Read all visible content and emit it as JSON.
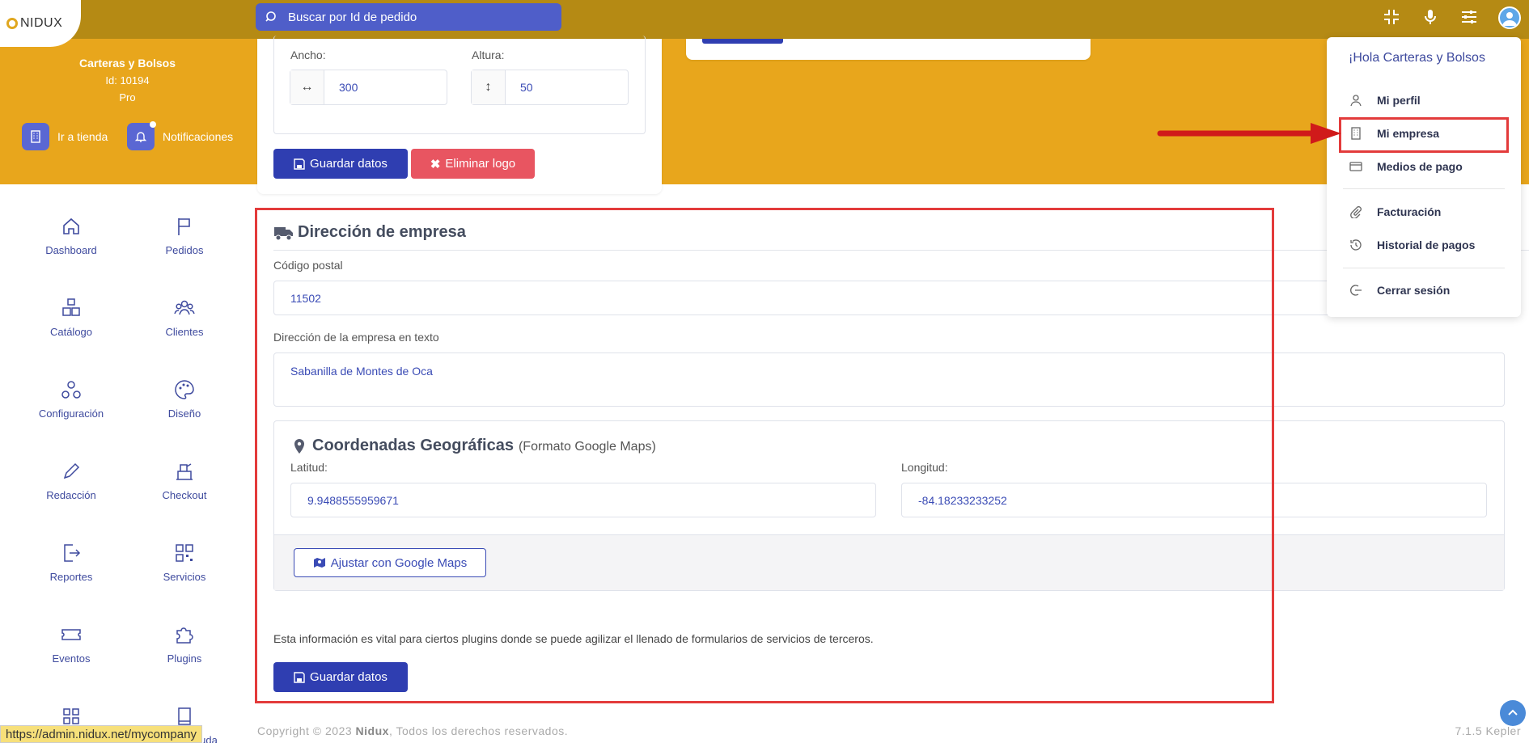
{
  "topbar": {
    "logo_text": "NIDUX",
    "search_placeholder": "Buscar por Id de pedido"
  },
  "store": {
    "name": "Carteras y Bolsos",
    "id_label": "Id: 10194",
    "plan": "Pro",
    "go_store": "Ir a tienda",
    "notifications": "Notificaciones"
  },
  "sidebar": {
    "items": [
      {
        "label": "Dashboard",
        "icon": "home-icon"
      },
      {
        "label": "Pedidos",
        "icon": "flag-icon"
      },
      {
        "label": "Catálogo",
        "icon": "boxes-icon"
      },
      {
        "label": "Clientes",
        "icon": "users-icon"
      },
      {
        "label": "Configuración",
        "icon": "nodes-icon"
      },
      {
        "label": "Diseño",
        "icon": "palette-icon"
      },
      {
        "label": "Redacción",
        "icon": "pencil-icon"
      },
      {
        "label": "Checkout",
        "icon": "register-icon"
      },
      {
        "label": "Reportes",
        "icon": "export-icon"
      },
      {
        "label": "Servicios",
        "icon": "qr-icon"
      },
      {
        "label": "Eventos",
        "icon": "ticket-icon"
      },
      {
        "label": "Plugins",
        "icon": "puzzle-icon"
      },
      {
        "label": "",
        "icon": "grid-icon"
      },
      {
        "label": "uda",
        "icon": "book-icon"
      }
    ]
  },
  "logo_section": {
    "width_label": "Ancho:",
    "width_value": "300",
    "height_label": "Altura:",
    "height_value": "50",
    "save_label": "Guardar datos",
    "delete_label": "Eliminar logo"
  },
  "address": {
    "title": "Dirección de empresa",
    "postal_label": "Código postal",
    "postal_value": "11502",
    "text_label": "Dirección de la empresa en texto",
    "text_value": "Sabanilla de Montes de Oca",
    "geo_title": "Coordenadas Geográficas",
    "geo_subtitle": "(Formato Google Maps)",
    "lat_label": "Latitud:",
    "lat_value": "9.9488555959671",
    "lng_label": "Longitud:",
    "lng_value": "-84.18233233252",
    "maps_button": "Ajustar con Google Maps",
    "note": "Esta información es vital para ciertos plugins donde se puede agilizar el llenado de formularios de servicios de terceros.",
    "save_label": "Guardar datos"
  },
  "footer": {
    "copyright_prefix": "Copyright © 2023 ",
    "brand": "Nidux",
    "copyright_suffix": ", Todos los derechos reservados.",
    "version": "7.1.5 Kepler"
  },
  "status_url": "https://admin.nidux.net/mycompany",
  "dropdown": {
    "greeting": "¡Hola Carteras y Bolsos",
    "items": [
      {
        "label": "Mi perfil",
        "icon": "user-icon"
      },
      {
        "label": "Mi empresa",
        "icon": "building-icon"
      },
      {
        "label": "Medios de pago",
        "icon": "credit-card-icon"
      },
      {
        "label": "Facturación",
        "icon": "paperclip-icon"
      },
      {
        "label": "Historial de pagos",
        "icon": "history-icon"
      },
      {
        "label": "Cerrar sesión",
        "icon": "logout-icon"
      }
    ]
  },
  "colors": {
    "topbar": "#b58a14",
    "band": "#e8a61c",
    "primary": "#2f3eb1",
    "danger": "#e85561",
    "highlight": "#e33b3b"
  }
}
